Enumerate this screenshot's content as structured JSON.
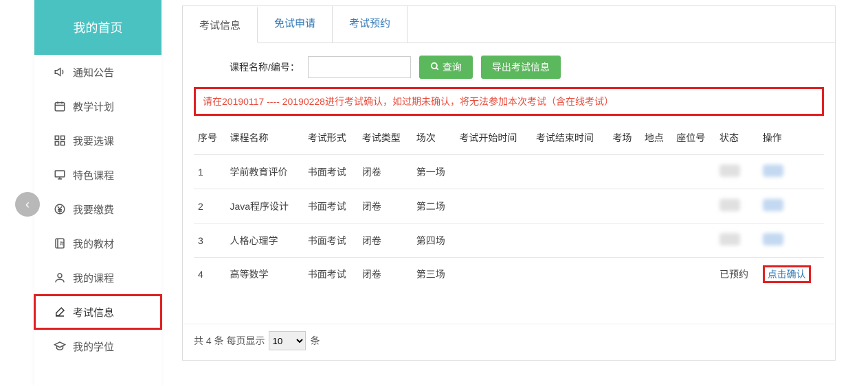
{
  "nav_back_glyph": "‹",
  "sidebar": {
    "header": "我的首页",
    "items": [
      {
        "label": "通知公告",
        "icon": "speaker",
        "color": "c-teal"
      },
      {
        "label": "教学计划",
        "icon": "calendar",
        "color": "c-orange"
      },
      {
        "label": "我要选课",
        "icon": "grid",
        "color": "c-green"
      },
      {
        "label": "特色课程",
        "icon": "board",
        "color": "c-orange"
      },
      {
        "label": "我要缴费",
        "icon": "yen",
        "color": "c-red"
      },
      {
        "label": "我的教材",
        "icon": "book",
        "color": "c-orange"
      },
      {
        "label": "我的课程",
        "icon": "person",
        "color": "c-blue"
      },
      {
        "label": "考试信息",
        "icon": "pencil",
        "color": "c-blue",
        "active": true,
        "highlighted": true
      },
      {
        "label": "我的学位",
        "icon": "cap",
        "color": "c-blue"
      }
    ]
  },
  "tabs": [
    {
      "label": "考试信息",
      "active": true
    },
    {
      "label": "免试申请"
    },
    {
      "label": "考试预约"
    }
  ],
  "toolbar": {
    "label": "课程名称/编号：",
    "input_value": "",
    "search_label": "查询",
    "export_label": "导出考试信息"
  },
  "notice": "请在20190117 ---- 20190228进行考试确认，如过期未确认，将无法参加本次考试（含在线考试）",
  "table": {
    "headers": [
      "序号",
      "课程名称",
      "考试形式",
      "考试类型",
      "场次",
      "考试开始时间",
      "考试结束时间",
      "考场",
      "地点",
      "座位号",
      "状态",
      "操作"
    ],
    "rows": [
      {
        "no": "1",
        "course": "学前教育评价",
        "form": "书面考试",
        "type": "闭卷",
        "session": "第一场",
        "start": "",
        "end": "",
        "room": "",
        "place": "",
        "seat": "",
        "status": "",
        "status_blur": true,
        "op": "",
        "op_blur": true
      },
      {
        "no": "2",
        "course": "Java程序设计",
        "form": "书面考试",
        "type": "闭卷",
        "session": "第二场",
        "start": "",
        "end": "",
        "room": "",
        "place": "",
        "seat": "",
        "status": "",
        "status_blur": true,
        "op": "",
        "op_blur": true
      },
      {
        "no": "3",
        "course": "人格心理学",
        "form": "书面考试",
        "type": "闭卷",
        "session": "第四场",
        "start": "",
        "end": "",
        "room": "",
        "place": "",
        "seat": "",
        "status": "",
        "status_blur": true,
        "op": "",
        "op_blur": true
      },
      {
        "no": "4",
        "course": "高等数学",
        "form": "书面考试",
        "type": "闭卷",
        "session": "第三场",
        "start": "",
        "end": "",
        "room": "",
        "place": "",
        "seat": "",
        "status": "已预约",
        "op": "点击确认",
        "op_highlight": true
      }
    ]
  },
  "pager": {
    "prefix": "共 4 条 每页显示",
    "size": "10",
    "suffix": "条"
  }
}
